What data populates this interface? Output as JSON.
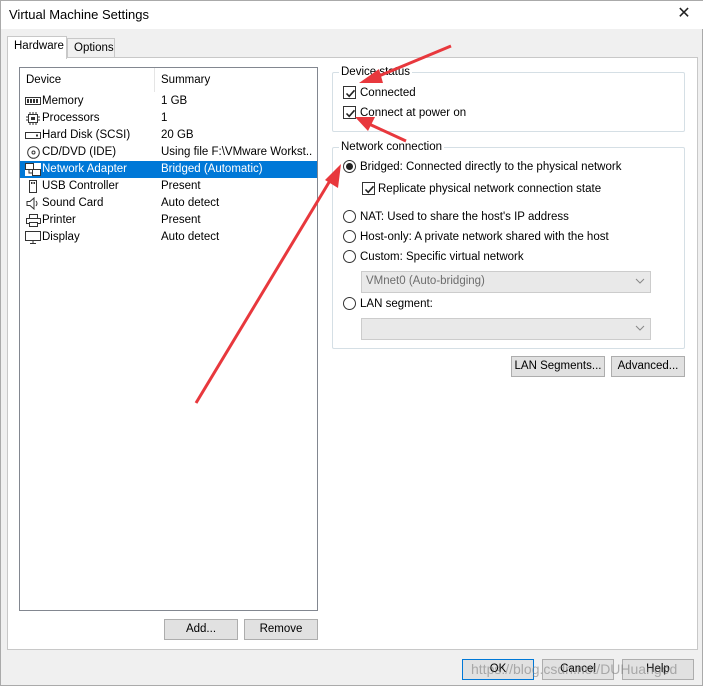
{
  "window": {
    "title": "Virtual Machine Settings",
    "close_glyph": "✕"
  },
  "tabs": [
    {
      "label": "Hardware"
    },
    {
      "label": "Options"
    }
  ],
  "device_list": {
    "headers": {
      "device": "Device",
      "summary": "Summary"
    },
    "rows": [
      {
        "name": "Memory",
        "summary": "1 GB",
        "icon": "memory-icon"
      },
      {
        "name": "Processors",
        "summary": "1",
        "icon": "processor-icon"
      },
      {
        "name": "Hard Disk (SCSI)",
        "summary": "20 GB",
        "icon": "hard-disk-icon"
      },
      {
        "name": "CD/DVD (IDE)",
        "summary": "Using file F:\\VMware Workst...",
        "icon": "cd-dvd-icon"
      },
      {
        "name": "Network Adapter",
        "summary": "Bridged (Automatic)",
        "icon": "network-adapter-icon"
      },
      {
        "name": "USB Controller",
        "summary": "Present",
        "icon": "usb-icon"
      },
      {
        "name": "Sound Card",
        "summary": "Auto detect",
        "icon": "speaker-icon"
      },
      {
        "name": "Printer",
        "summary": "Present",
        "icon": "printer-icon"
      },
      {
        "name": "Display",
        "summary": "Auto detect",
        "icon": "monitor-icon"
      }
    ],
    "add_label": "Add...",
    "remove_label": "Remove"
  },
  "device_status": {
    "legend": "Device status",
    "connected_label": "Connected",
    "connected_checked": true,
    "power_on_label": "Connect at power on",
    "power_on_checked": true
  },
  "network_connection": {
    "legend": "Network connection",
    "bridged_label": "Bridged: Connected directly to the physical network",
    "replicate_label": "Replicate physical network connection state",
    "replicate_checked": true,
    "nat_label": "NAT: Used to share the host's IP address",
    "host_only_label": "Host-only: A private network shared with the host",
    "custom_label": "Custom: Specific virtual network",
    "custom_select_value": "VMnet0 (Auto-bridging)",
    "lan_segment_label": "LAN segment:",
    "lan_segment_value": "",
    "selected": "bridged"
  },
  "buttons": {
    "lan_segments": "LAN Segments...",
    "advanced": "Advanced...",
    "ok": "OK",
    "cancel": "Cancel",
    "help": "Help"
  },
  "watermark": "https://blog.csdn.net/DUHuangod",
  "colors": {
    "selection": "#0078d7",
    "annotation_arrow": "#e8383d"
  }
}
